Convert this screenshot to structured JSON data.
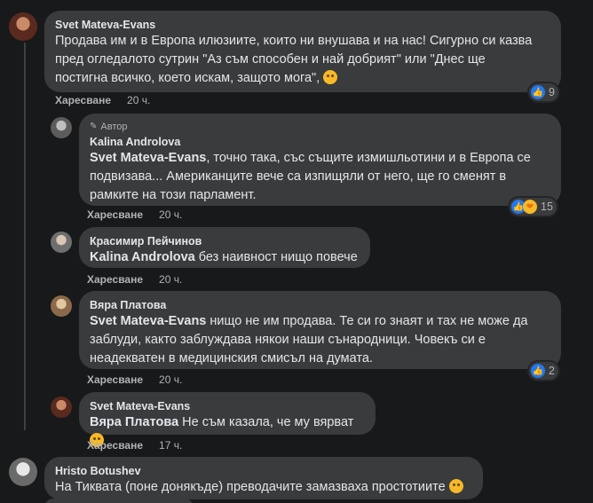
{
  "comments": [
    {
      "author": "Svet Mateva-Evans",
      "lines": [
        "Продава им и в Европа илюзиите, които ни внушава и на нас! Сигурно си казва",
        "пред огледалото сутрин \"Аз съм способен и най добрият\" или \"Днес ще",
        "постигна всичко, което искам, защото мога\","
      ],
      "like_label": "Харесване",
      "time": "20 ч.",
      "reaction_count": "9"
    },
    {
      "badge": "Автор",
      "author": "Kalina Androlova",
      "mention": "Svet Mateva-Evans",
      "lines": [
        ", точно така, със същите измишльотини и в Европа се",
        "подвизава... Американците вече са изпищяли от него, ще го сменят в",
        "рамките на този парламент."
      ],
      "like_label": "Харесване",
      "time": "20 ч.",
      "reaction_count": "15"
    },
    {
      "author": "Красимир Пейчинов",
      "mention": "Kalina Androlova",
      "text": " без наивност нищо повече",
      "like_label": "Харесване",
      "time": "20 ч."
    },
    {
      "author": "Вяра Платова",
      "mention": "Svet Mateva-Evans",
      "lines": [
        " нищо не им продава. Те си го знаят и тах не може да",
        "заблуди, както заблуждава някои наши сънародници. Човекъ си е",
        "неадекватен в медицинския смисъл на думата."
      ],
      "like_label": "Харесване",
      "time": "20 ч.",
      "reaction_count": "2"
    },
    {
      "author": "Svet Mateva-Evans",
      "mention": "Вяра Платова",
      "text": " Не съм казала, че му вярват",
      "like_label": "Харесване",
      "time": "17 ч."
    },
    {
      "author": "Hristo Botushev",
      "text": "На Тиквата (поне донякъде) преводачите замазваха простотиите"
    }
  ],
  "colors": {
    "like_blue": "#2078f4",
    "haha_yellow": "#f7b928",
    "bubble": "#3a3b3c"
  }
}
